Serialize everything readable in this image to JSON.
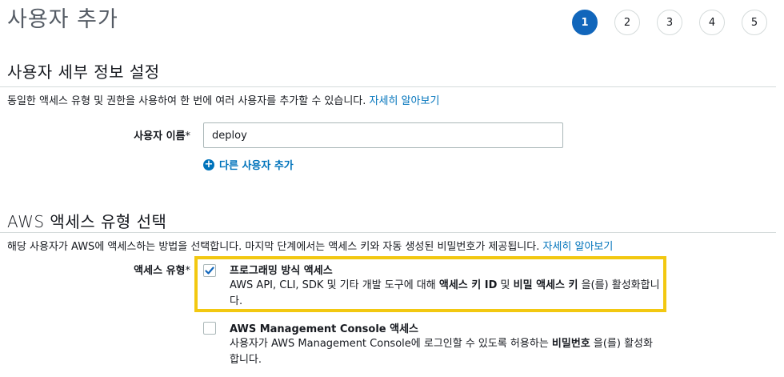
{
  "header": {
    "title": "사용자 추가",
    "steps": [
      "1",
      "2",
      "3",
      "4",
      "5"
    ],
    "active_step": "1"
  },
  "details": {
    "title": "사용자 세부 정보 설정",
    "description": "동일한 액세스 유형 및 권한을 사용하여 한 번에 여러 사용자를 추가할 수 있습니다.",
    "learn_more": "자세히 알아보기",
    "username_label": "사용자 이름",
    "required_mark": "*",
    "username_value": "deploy",
    "add_user_label": "다른 사용자 추가"
  },
  "access": {
    "title": "AWS 액세스 유형 선택",
    "description": "해당 사용자가 AWS에 액세스하는 방법을 선택합니다. 마지막 단계에서는 액세스 키와 자동 생성된 비밀번호가 제공됩니다.",
    "learn_more": "자세히 알아보기",
    "type_label": "액세스 유형",
    "required_mark": "*",
    "options": [
      {
        "title": "프로그래밍 방식 액세스",
        "checked": true,
        "desc_a": "AWS API, CLI, SDK 및 기타 개발 도구에 대해 ",
        "desc_b": "액세스 키 ID",
        "desc_c": " 및 ",
        "desc_d": "비밀 액세스 키",
        "desc_e": " 을(를) 활성화합니다."
      },
      {
        "title": "AWS Management Console 액세스",
        "checked": false,
        "desc_a": "사용자가 AWS Management Console에 로그인할 수 있도록 허용하는 ",
        "desc_b": "비밀번호",
        "desc_c": " 을(를) 활성화합니다."
      }
    ]
  },
  "colors": {
    "accent": "#1166bb",
    "link": "#0073bb",
    "highlight": "#f2c811"
  }
}
